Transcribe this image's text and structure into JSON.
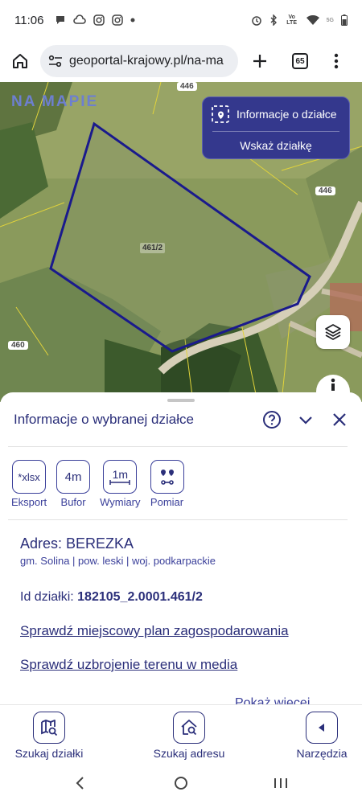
{
  "status_bar": {
    "time": "11:06",
    "network_label": "Vo LTE",
    "signal_label": "5G"
  },
  "browser": {
    "url": "geoportal-krajowy.pl/na-ma",
    "tabs_count": "65"
  },
  "map": {
    "logo": "NA MAPIE",
    "parcel_number": "461/2",
    "road_labels": [
      "446",
      "446",
      "460"
    ],
    "info_card": {
      "title": "Informacje o działce",
      "button": "Wskaż działkę"
    }
  },
  "sheet": {
    "title": "Informacje o wybranej działce",
    "tools": [
      {
        "icon_text": "*xlsx",
        "label": "Eksport"
      },
      {
        "icon_text": "4m",
        "label": "Bufor"
      },
      {
        "icon_text": "1m",
        "label": "Wymiary"
      },
      {
        "icon_text": "",
        "label": "Pomiar"
      }
    ],
    "address": "Adres: BEREZKA",
    "admin": "gm. Solina | pow. leski | woj. podkarpackie",
    "parcel_id_label": "Id działki:",
    "parcel_id_value": "182105_2.0001.461/2",
    "link_plan": "Sprawdź miejscowy plan zagospodarowania",
    "link_media": "Sprawdź uzbrojenie terenu w media",
    "more": "Pokaż więcej"
  },
  "bottom_nav": {
    "items": [
      {
        "label": "Szukaj działki"
      },
      {
        "label": "Szukaj adresu"
      },
      {
        "label": "Narzędzia"
      }
    ]
  },
  "colors": {
    "accent": "#2b2f7a",
    "card": "#34388d",
    "parcel_outline": "#1a1a8c"
  }
}
